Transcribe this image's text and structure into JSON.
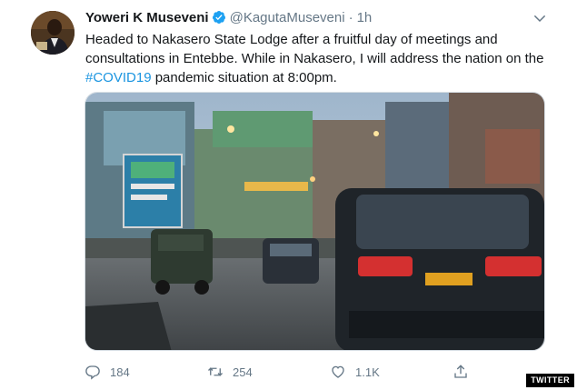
{
  "tweet": {
    "author_name": "Yoweri K Museveni",
    "handle": "@KagutaMuseveni",
    "separator": "·",
    "time": "1h",
    "text_before": "Headed to Nakasero State Lodge after a fruitful day of meetings and consultations in Entebbe. While in Nakasero, I will address the nation on the ",
    "hashtag": "#COVID19",
    "text_after": " pandemic situation at 8:00pm."
  },
  "actions": {
    "reply_count": "184",
    "retweet_count": "254",
    "like_count": "1.1K"
  },
  "icons": {
    "verified": "verified-badge-icon",
    "menu": "chevron-down-icon",
    "reply": "reply-icon",
    "retweet": "retweet-icon",
    "like": "heart-icon",
    "share": "share-icon"
  },
  "colors": {
    "accent": "#1b95e0",
    "muted": "#657786",
    "verified": "#1da1f2"
  },
  "watermark": "TWITTER"
}
